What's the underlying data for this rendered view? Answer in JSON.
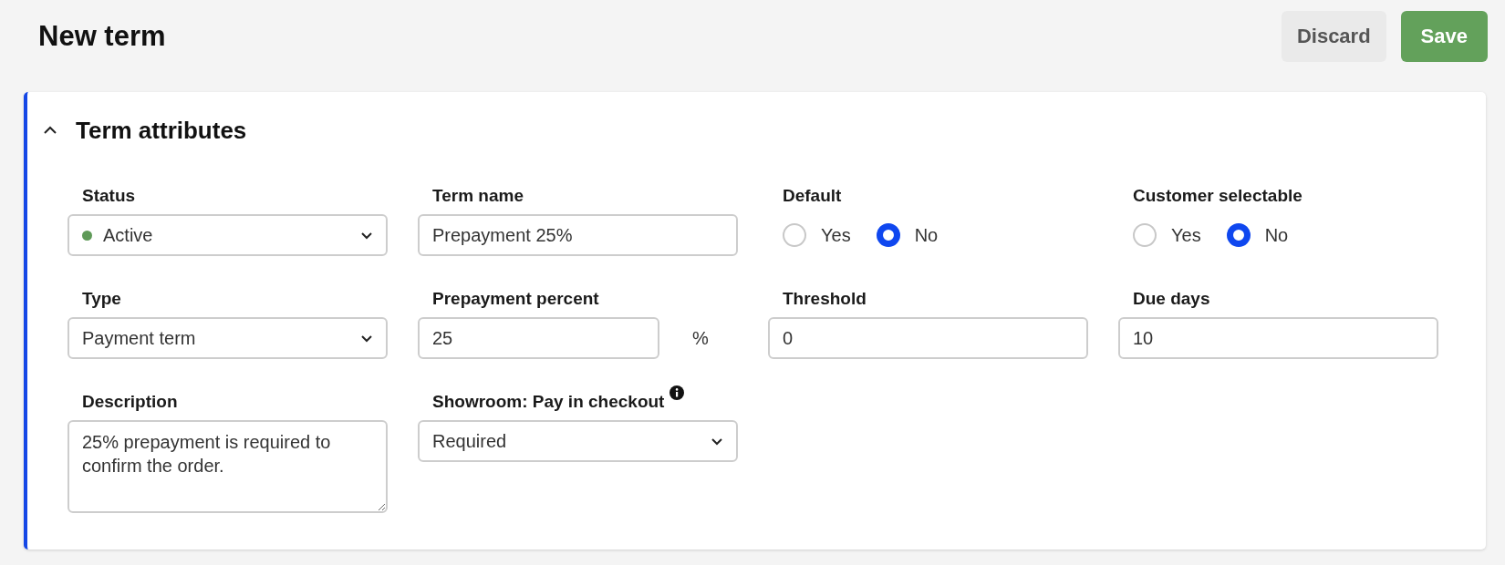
{
  "page": {
    "title": "New term"
  },
  "actions": [
    {
      "label": "Discard",
      "kind": "secondary"
    },
    {
      "label": "Save",
      "kind": "primary"
    }
  ],
  "section": {
    "title": "Term attributes",
    "expanded": true,
    "fields": [
      {
        "kind": "select",
        "label": "Status",
        "value": "Active",
        "color": "#5f9a58"
      },
      {
        "kind": "text",
        "label": "Term name",
        "value": "Prepayment 25%"
      },
      {
        "kind": "radio",
        "label": "Default",
        "options": [
          {
            "label": "Yes",
            "selected": false
          },
          {
            "label": "No",
            "selected": true
          }
        ]
      },
      {
        "kind": "radio",
        "label": "Customer selectable",
        "options": [
          {
            "label": "Yes",
            "selected": false
          },
          {
            "label": "No",
            "selected": true
          }
        ]
      },
      {
        "kind": "select",
        "label": "Type",
        "value": "Payment term"
      },
      {
        "kind": "number",
        "label": "Prepayment percent",
        "value": "25",
        "unit": "%"
      },
      {
        "kind": "text",
        "label": "Threshold",
        "value": "0"
      },
      {
        "kind": "text",
        "label": "Due days",
        "value": "10"
      },
      {
        "kind": "textarea",
        "label": "Description",
        "value": "25% prepayment is required to confirm the order."
      },
      {
        "kind": "select",
        "label": "Showroom: Pay in checkout",
        "value": "Required",
        "info": true
      }
    ]
  }
}
